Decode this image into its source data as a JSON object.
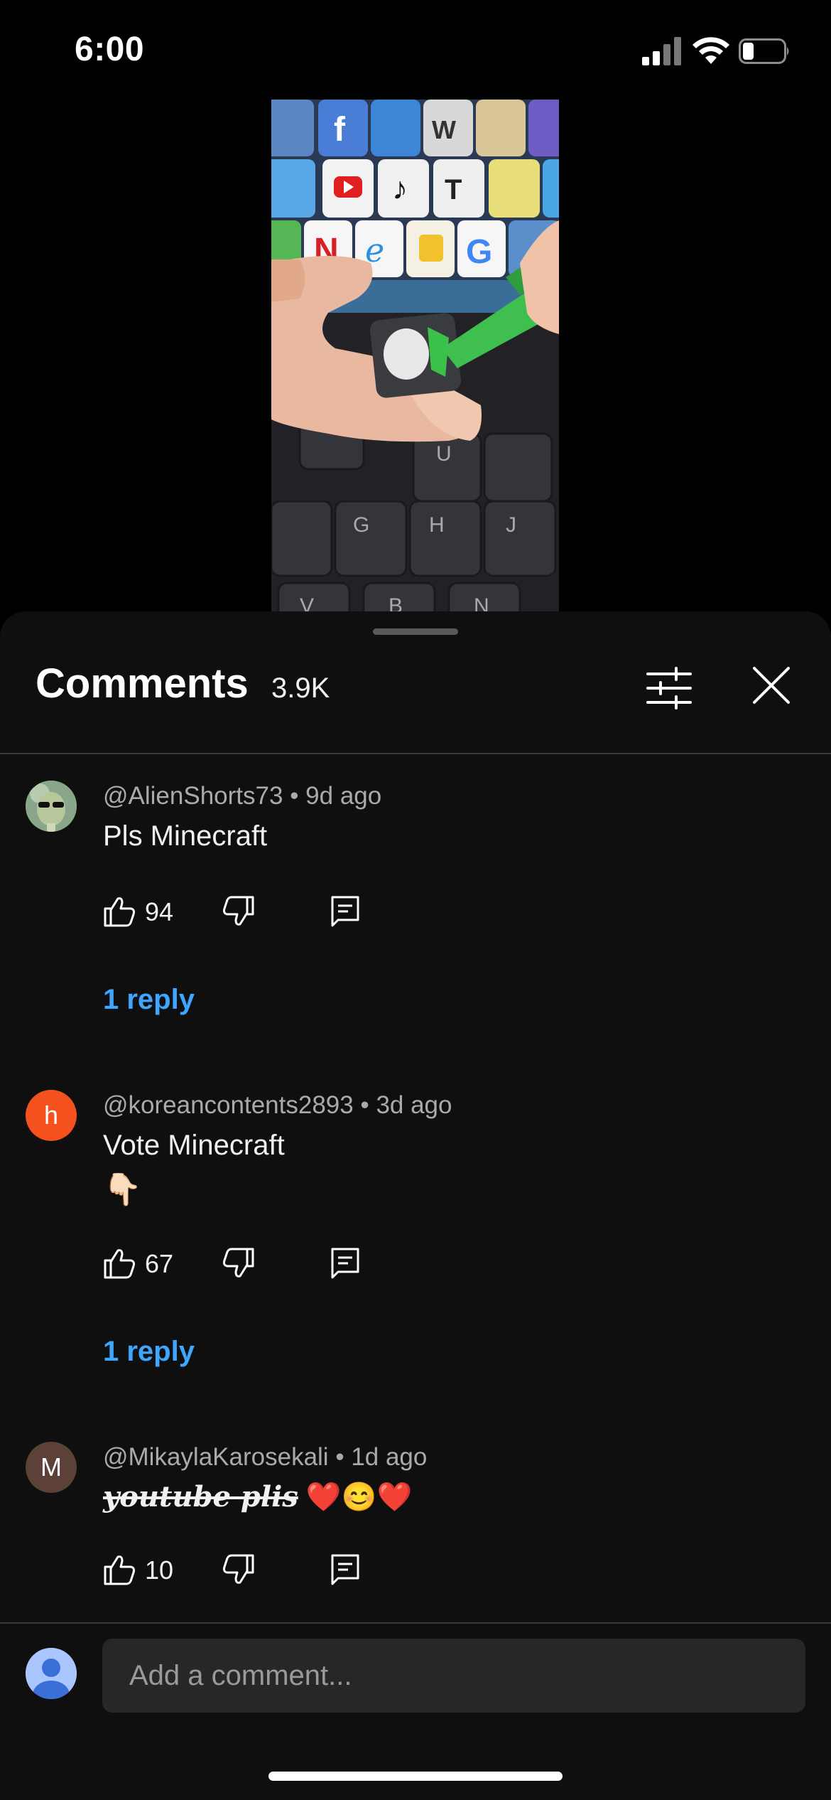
{
  "status_bar": {
    "time": "6:00"
  },
  "comments_panel": {
    "title": "Comments",
    "count": "3.9K",
    "comments": [
      {
        "author": "@AlienShorts73",
        "age": "9d ago",
        "text": "Pls Minecraft",
        "likes": "94",
        "replies_label": "1 reply"
      },
      {
        "author": "@koreancontents2893",
        "age": "3d ago",
        "avatar_letter": "h",
        "text": "Vote Minecraft",
        "emoji": "👇🏻",
        "likes": "67",
        "replies_label": "1 reply"
      },
      {
        "author": "@MikaylaKarosekali",
        "age": "1d ago",
        "avatar_letter": "M",
        "text_struck": "youtube plis",
        "emoji": "❤️😊❤️",
        "likes": "10"
      }
    ],
    "add_comment_placeholder": "Add a comment..."
  },
  "colors": {
    "reply_link": "#3ea6ff",
    "sheet_bg": "#0f0f0f",
    "avatar_h": "#f4511e",
    "avatar_m": "#5d4037"
  }
}
